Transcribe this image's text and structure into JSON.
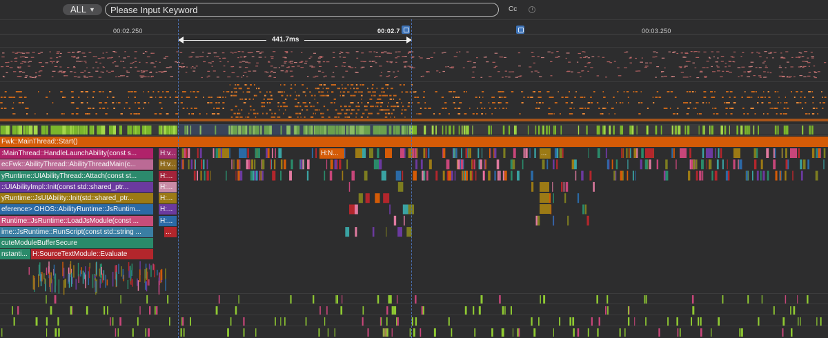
{
  "toolbar": {
    "scope": "ALL",
    "search_placeholder": "Please Input Keyword",
    "case_toggle": "Cc"
  },
  "ruler": {
    "ticks": [
      "00:02.250",
      "00:02.7",
      "00:03.250"
    ]
  },
  "selection": {
    "duration": "441.7ms"
  },
  "colors": {
    "main_thread": "#d45b07",
    "activity": "#8fc932",
    "background": "#2d2d2e",
    "selection_line": "#4a6fb0"
  },
  "call_stack": [
    "Fwk::MainThread::Start()",
    ":MainThread::HandleLaunchAbility(const s...",
    "ecFwk::AbilityThread::AbilityThreadMain(c...",
    "yRuntime::UIAbilityThread::Attach(const st...",
    "::UIAbilityImpl::Init(const std::shared_ptr...",
    "yRuntime::JsUIAbility::Init(std::shared_ptr...",
    "eference> OHOS::AbilityRuntime::JsRuntim...",
    "Runtime::JsRuntime::LoadJsModule(const ...",
    "ime::JsRuntime::RunScript(const std::string ...",
    "cuteModuleBufferSecure",
    "nstanti...",
    "H:SourceTextModule::Evaluate"
  ],
  "side_slices": [
    "H:v...",
    "H:v...",
    "H:...",
    "H:...",
    "H:...",
    "H:...",
    "H:...",
    "..."
  ],
  "inner_slices": [
    "H:N...",
    "..."
  ]
}
